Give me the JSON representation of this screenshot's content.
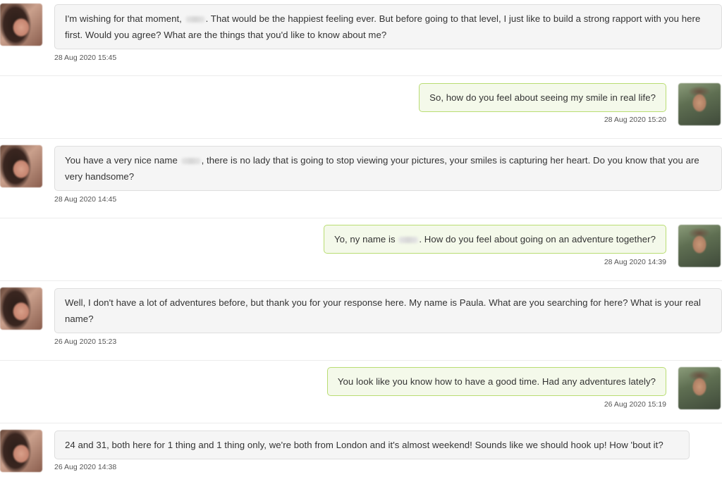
{
  "messages": [
    {
      "sender": "her",
      "parts": [
        "I'm wishing for that moment, ",
        ". That would be the happiest feeling ever. But before going to that level, I just like to build a strong rapport with you here first. Would you agree? What are the things that you'd like to know about me?"
      ],
      "timestamp": "28 Aug 2020 15:45"
    },
    {
      "sender": "me",
      "text": "So, how do you feel about seeing my smile in real life?",
      "timestamp": "28 Aug 2020 15:20"
    },
    {
      "sender": "her",
      "parts": [
        "You have a very nice name ",
        ", there is no lady that is going to stop viewing your pictures, your smiles is capturing her heart. Do you know that you are very handsome?"
      ],
      "timestamp": "28 Aug 2020 14:45"
    },
    {
      "sender": "me",
      "parts": [
        "Yo, ny name is ",
        ". How do you feel about going on an adventure together?"
      ],
      "timestamp": "28 Aug 2020 14:39"
    },
    {
      "sender": "her",
      "text": "Well, I don't have a lot of adventures before, but thank you for your response here. My name is Paula. What are you searching for here? What is your real name?",
      "timestamp": "26 Aug 2020 15:23"
    },
    {
      "sender": "me",
      "text": "You look like you know how to have a good time. Had any adventures lately?",
      "timestamp": "26 Aug 2020 15:19"
    },
    {
      "sender": "her",
      "text": "24 and 31, both here for 1 thing and 1 thing only, we're both from London and it's almost weekend! Sounds like we should hook up! How 'bout it?",
      "timestamp": "26 Aug 2020 14:38"
    }
  ],
  "colors": {
    "her_bubble_bg": "#f5f5f5",
    "her_bubble_border": "#dedede",
    "my_bubble_bg": "#f4f9ea",
    "my_bubble_border": "#b9dd73"
  },
  "icons": {
    "her_avatar": "profile-photo-woman",
    "my_avatar": "profile-photo-man",
    "redacted_name": "blurred-text"
  }
}
